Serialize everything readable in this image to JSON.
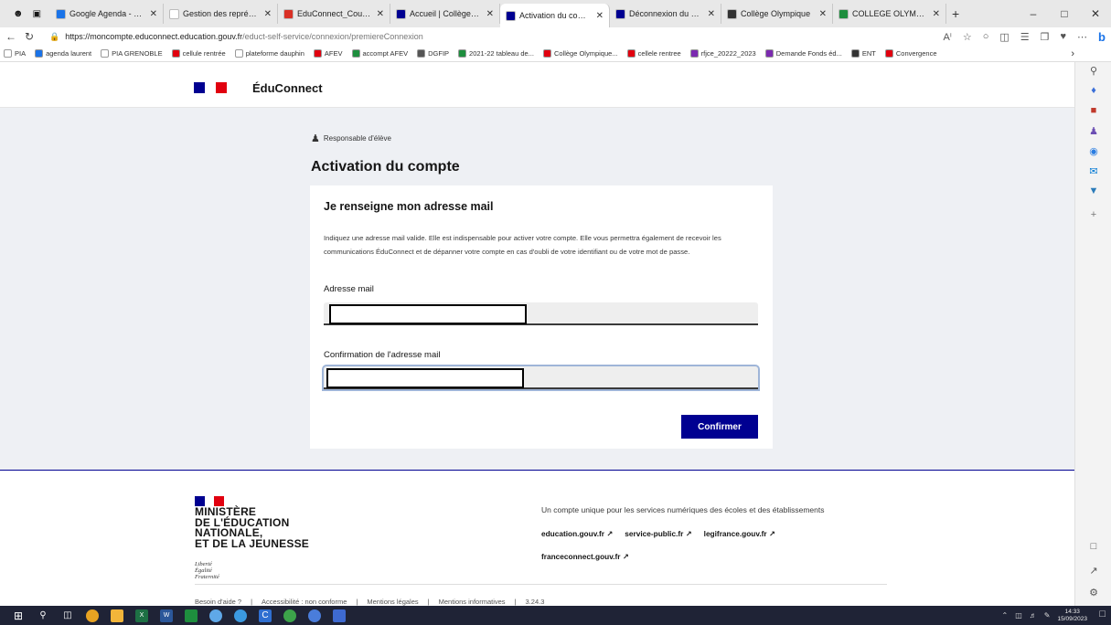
{
  "browser": {
    "tabs": [
      {
        "label": "Google Agenda - Semaine",
        "color": "#1a73e8"
      },
      {
        "label": "Gestion des représentants",
        "color": "#ffffff"
      },
      {
        "label": "EduConnect_CourrierResp",
        "color": "#d93025"
      },
      {
        "label": "Accueil | Collège Olympique",
        "color": "#000091"
      },
      {
        "label": "Activation du compte resp",
        "color": "#000091",
        "active": true
      },
      {
        "label": "Déconnexion du compte",
        "color": "#000091"
      },
      {
        "label": "Collège Olympique",
        "color": "#333333"
      },
      {
        "label": "COLLEGE OLYMPIQUE - Pi",
        "color": "#1e8e3e"
      }
    ],
    "new_tab": "+",
    "url_host": "https://moncompte.educonnect.education.gouv.fr",
    "url_path": "/educt-self-service/connexion/premiereConnexion",
    "bookmarks": [
      {
        "label": "PIA",
        "color": "#ffffff"
      },
      {
        "label": "agenda laurent",
        "color": "#1a73e8"
      },
      {
        "label": "PIA GRENOBLE",
        "color": "#ffffff"
      },
      {
        "label": "cellule rentrée",
        "color": "#e1000f"
      },
      {
        "label": "plateforme dauphin",
        "color": "#ffffff"
      },
      {
        "label": "AFEV",
        "color": "#e1000f"
      },
      {
        "label": "accompt AFEV",
        "color": "#1e8e3e"
      },
      {
        "label": "DGFIP",
        "color": "#555555"
      },
      {
        "label": "2021-22 tableau de...",
        "color": "#1e8e3e"
      },
      {
        "label": "Collège Olympique...",
        "color": "#e1000f"
      },
      {
        "label": "cellele rentree",
        "color": "#e1000f"
      },
      {
        "label": "rfjce_20222_2023",
        "color": "#7b2ab0"
      },
      {
        "label": "Demande Fonds éd...",
        "color": "#7b2ab0"
      },
      {
        "label": "ENT",
        "color": "#333333"
      },
      {
        "label": "Convergence",
        "color": "#e1000f"
      }
    ]
  },
  "header": {
    "brand": "ÉduConnect"
  },
  "main": {
    "role": "Responsable d'élève",
    "title": "Activation du compte",
    "card_title": "Je renseigne mon adresse mail",
    "description": "Indiquez une adresse mail valide. Elle est indispensable pour activer votre compte. Elle vous permettra également de recevoir les communications ÉduConnect et de dépanner votre compte en cas d'oubli de votre identifiant ou de votre mot de passe.",
    "email_label": "Adresse mail",
    "email_value": "",
    "confirm_label": "Confirmation de l'adresse mail",
    "confirm_value": "",
    "submit": "Confirmer"
  },
  "footer": {
    "ministry_lines": [
      "MINISTÈRE",
      "DE L'ÉDUCATION",
      "NATIONALE,",
      "ET DE LA JEUNESSE"
    ],
    "motto": [
      "Liberté",
      "Égalité",
      "Fraternité"
    ],
    "tagline": "Un compte unique pour les services numériques des écoles et des établissements",
    "links": [
      "education.gouv.fr",
      "service-public.fr",
      "legifrance.gouv.fr"
    ],
    "link2": "franceconnect.gouv.fr",
    "bottom_links": [
      "Besoin d'aide ?",
      "Accessibilité : non conforme",
      "Mentions légales",
      "Mentions informatives",
      "3.24.3"
    ]
  },
  "taskbar": {
    "time": "14:33",
    "date": "15/09/2023"
  },
  "colors": {
    "accent": "#000091",
    "flag_blue": "#000091",
    "flag_red": "#e1000f",
    "band": "#eef0f4"
  }
}
